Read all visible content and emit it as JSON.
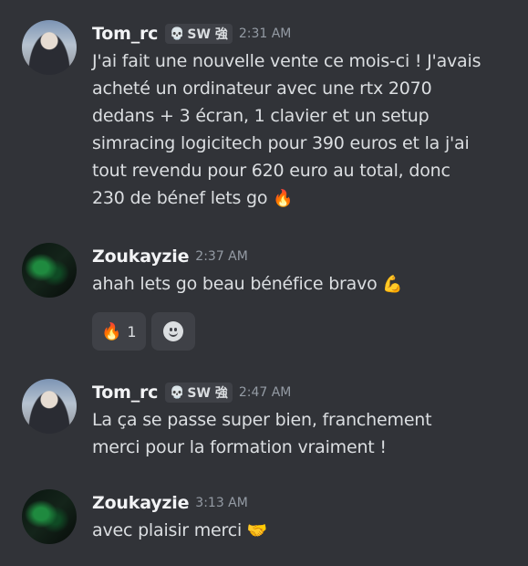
{
  "messages": [
    {
      "username": "Tom_rc",
      "tag_icon": "skull-icon",
      "tag": "SW 強",
      "timestamp": "2:31 AM",
      "text": "J'ai fait une nouvelle vente ce mois-ci ! J'avais\nacheté un ordinateur avec une rtx 2070\ndedans + 3 écran, 1 clavier et un setup\nsimracing logicitech pour 390 euros et la j'ai\ntout revendu pour 620 euro au total, donc\n230 de bénef lets go",
      "emoji": "🔥"
    },
    {
      "username": "Zoukayzie",
      "timestamp": "2:37 AM",
      "text": "ahah lets go beau bénéfice bravo",
      "emoji": "💪",
      "reactions": [
        {
          "emoji": "🔥",
          "count": "1"
        }
      ]
    },
    {
      "username": "Tom_rc",
      "tag_icon": "skull-icon",
      "tag": "SW 強",
      "timestamp": "2:47 AM",
      "text": "La ça se passe super bien, franchement\nmerci pour la formation vraiment !"
    },
    {
      "username": "Zoukayzie",
      "timestamp": "3:13 AM",
      "text": "avec plaisir merci",
      "emoji": "🤝"
    }
  ]
}
